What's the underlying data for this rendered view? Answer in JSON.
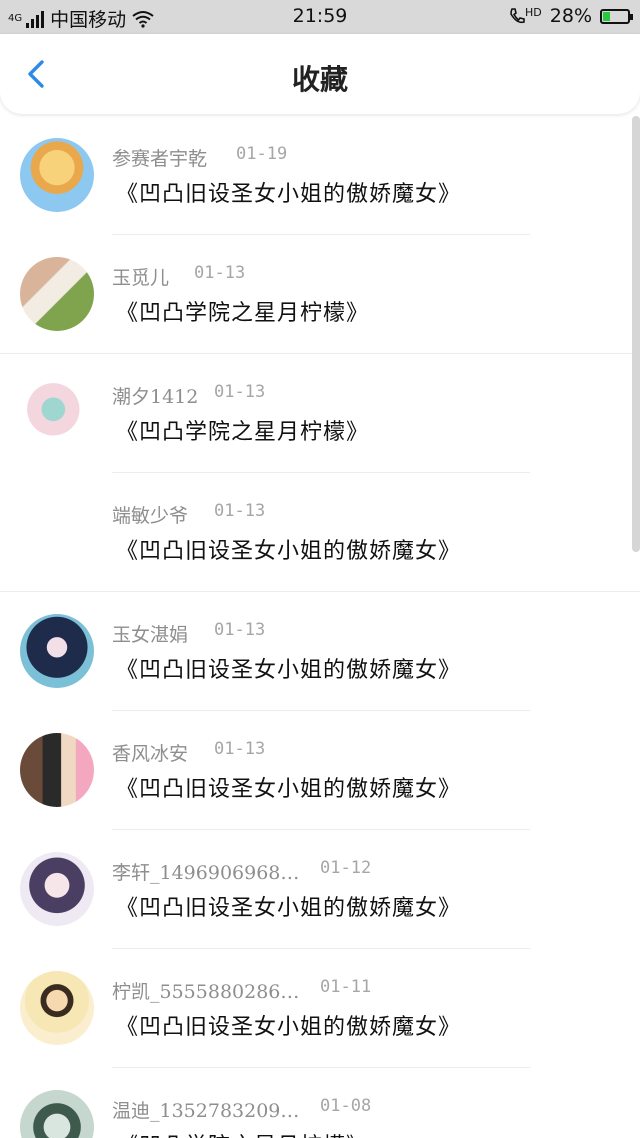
{
  "status_bar": {
    "network_type": "4G",
    "carrier": "中国移动",
    "time": "21:59",
    "hd_label": "HD",
    "battery": "28%",
    "battery_level": 0.28
  },
  "header": {
    "title": "收藏"
  },
  "favorites": [
    {
      "user": "参赛者宇乾",
      "date": "01-19",
      "book": "《凹凸旧设圣女小姐的傲娇魔女》"
    },
    {
      "user": "玉觅儿",
      "date": "01-13",
      "book": "《凹凸学院之星月柠檬》"
    },
    {
      "user": "潮夕1412",
      "date": "01-13",
      "book": "《凹凸学院之星月柠檬》"
    },
    {
      "user": "端敏少爷",
      "date": "01-13",
      "book": "《凹凸旧设圣女小姐的傲娇魔女》"
    },
    {
      "user": "玉女湛娟",
      "date": "01-13",
      "book": "《凹凸旧设圣女小姐的傲娇魔女》"
    },
    {
      "user": "香风冰安",
      "date": "01-13",
      "book": "《凹凸旧设圣女小姐的傲娇魔女》"
    },
    {
      "user": "李轩_1496906968…",
      "date": "01-12",
      "book": "《凹凸旧设圣女小姐的傲娇魔女》"
    },
    {
      "user": "柠凯_5555880286…",
      "date": "01-11",
      "book": "《凹凸旧设圣女小姐的傲娇魔女》"
    },
    {
      "user": "温迪_1352783209…",
      "date": "01-08",
      "book": "《凹凸学院之星月柠檬》"
    }
  ]
}
